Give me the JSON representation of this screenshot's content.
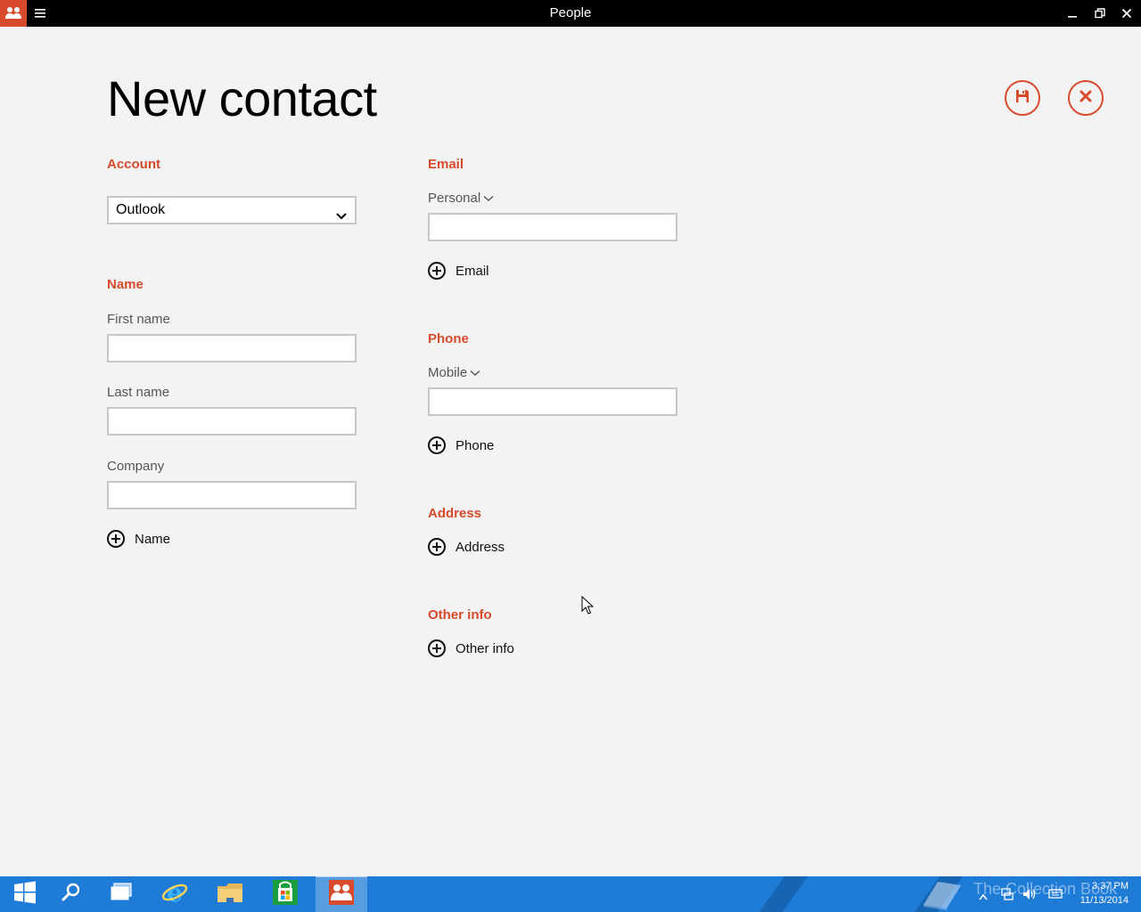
{
  "window": {
    "title": "People"
  },
  "page": {
    "title": "New contact"
  },
  "account": {
    "label": "Account",
    "selected": "Outlook"
  },
  "name_section": {
    "label": "Name",
    "first_name_label": "First name",
    "last_name_label": "Last name",
    "company_label": "Company",
    "add_label": "Name"
  },
  "email_section": {
    "label": "Email",
    "type": "Personal",
    "add_label": "Email"
  },
  "phone_section": {
    "label": "Phone",
    "type": "Mobile",
    "add_label": "Phone"
  },
  "address_section": {
    "label": "Address",
    "add_label": "Address"
  },
  "other_section": {
    "label": "Other info",
    "add_label": "Other info"
  },
  "taskbar": {
    "time": "3:37 PM",
    "date": "11/13/2014",
    "watermark": "The Collection Book"
  },
  "colors": {
    "accent": "#d84a2c",
    "taskbar": "#1e7bd6",
    "titlebar": "#000000",
    "background": "#f3f3f3"
  },
  "icons": {
    "app": "people-icon",
    "menu": "hamburger-icon",
    "save": "save-icon",
    "cancel": "close-icon",
    "add": "add-circle-icon"
  }
}
